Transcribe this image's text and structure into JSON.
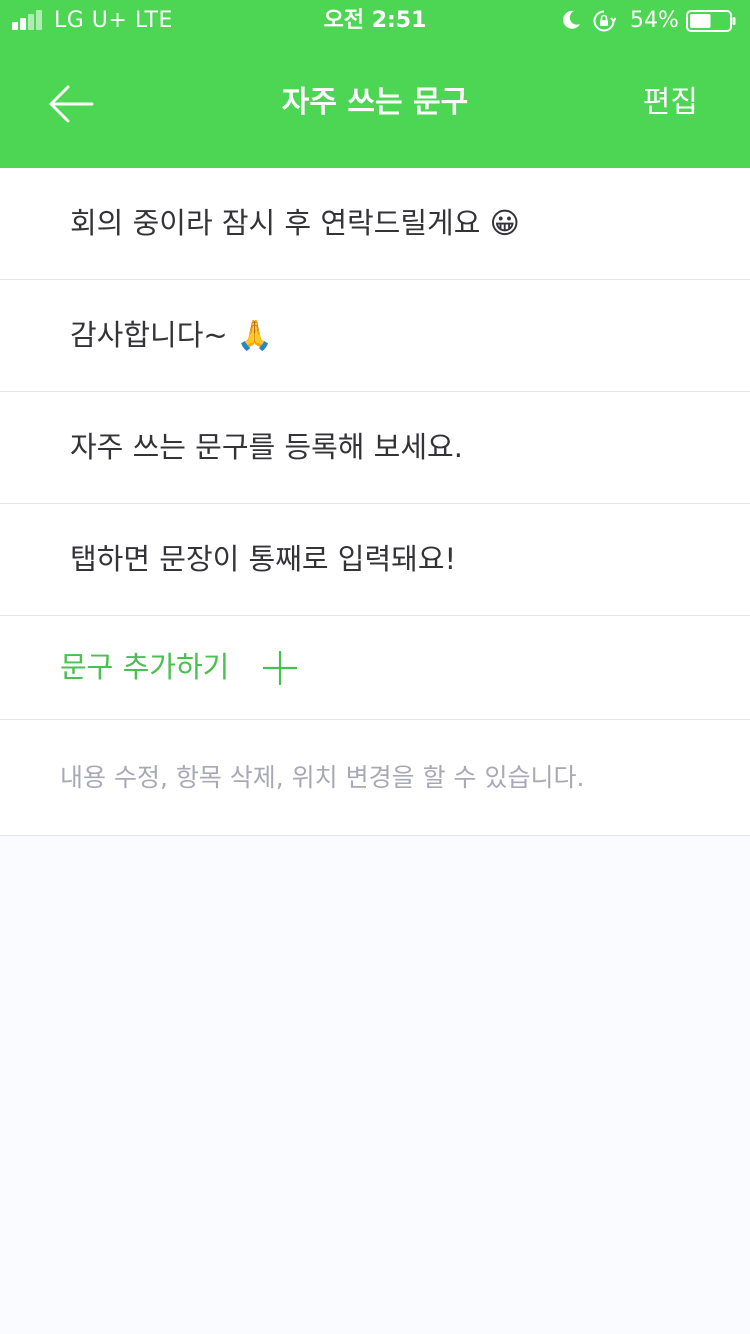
{
  "status_bar": {
    "carrier": "LG U+  LTE",
    "time": "오전 2:51",
    "battery": "54%",
    "battery_level": 0.54,
    "icons": [
      "signal-icon",
      "moon-icon",
      "rotation-lock-icon",
      "battery-icon"
    ]
  },
  "nav": {
    "title": "자주 쓰는 문구",
    "edit_label": "편집",
    "back_icon": "arrow-left-icon"
  },
  "phrases": [
    "회의 중이라 잠시 후 연락드릴게요 😀",
    "감사합니다~ 🙏",
    "자주 쓰는 문구를 등록해 보세요.",
    "탭하면 문장이 통째로 입력돼요!"
  ],
  "add_label": "문구 추가하기",
  "hint": "내용 수정, 항목 삭제, 위치 변경을 할 수 있습니다.",
  "colors": {
    "brand": "#4cd653",
    "accent_text": "#48c24e",
    "hint_text": "#a8a9b5",
    "background": "#fafbfe"
  }
}
